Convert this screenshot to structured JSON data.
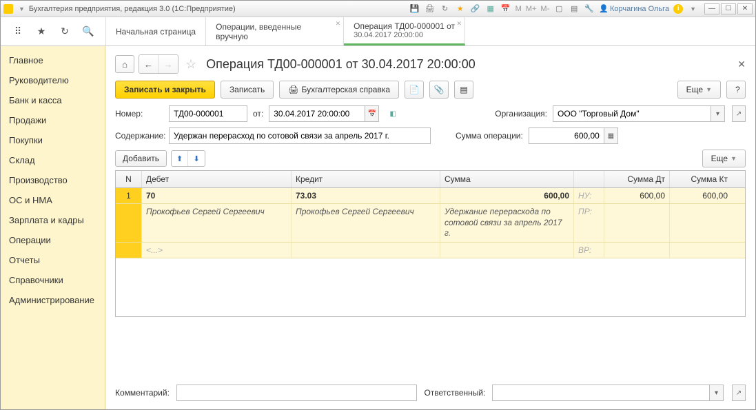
{
  "titlebar": {
    "title": "Бухгалтерия предприятия, редакция 3.0  (1С:Предприятие)",
    "user": "Корчагина Ольга",
    "m": "M",
    "mplus": "M+",
    "mminus": "M-"
  },
  "tabs": [
    {
      "label": "Начальная страница",
      "closable": false
    },
    {
      "label": "Операции, введенные вручную",
      "closable": true
    },
    {
      "label": "Операция ТД00-000001 от",
      "line2": "30.04.2017 20:00:00",
      "closable": true,
      "active": true
    }
  ],
  "sidebar": {
    "items": [
      "Главное",
      "Руководителю",
      "Банк и касса",
      "Продажи",
      "Покупки",
      "Склад",
      "Производство",
      "ОС и НМА",
      "Зарплата и кадры",
      "Операции",
      "Отчеты",
      "Справочники",
      "Администрирование"
    ]
  },
  "page": {
    "title": "Операция ТД00-000001 от 30.04.2017 20:00:00",
    "save_close": "Записать и закрыть",
    "save": "Записать",
    "report": "Бухгалтерская справка",
    "more": "Еще",
    "help": "?",
    "number_label": "Номер:",
    "number": "ТД00-000001",
    "from_label": "от:",
    "date": "30.04.2017 20:00:00",
    "org_label": "Организация:",
    "org": "ООО \"Торговый Дом\"",
    "content_label": "Содержание:",
    "content": "Удержан перерасход по сотовой связи за апрель 2017 г.",
    "sum_label": "Сумма операции:",
    "sum": "600,00",
    "add": "Добавить",
    "comment_label": "Комментарий:",
    "resp_label": "Ответственный:"
  },
  "grid": {
    "headers": {
      "n": "N",
      "debit": "Дебет",
      "credit": "Кредит",
      "sum": "Сумма",
      "sum_dt": "Сумма Дт",
      "sum_kt": "Сумма Кт"
    },
    "row": {
      "n": "1",
      "dt_acc": "70",
      "kt_acc": "73.03",
      "sum": "600,00",
      "tag_nu": "НУ:",
      "sum_dt": "600,00",
      "sum_kt": "600,00",
      "dt_sub": "Прокофьев Сергей Сергеевич",
      "kt_sub": "Прокофьев Сергей Сергеевич",
      "sum_desc": "Удержание перерасхода по сотовой связи за апрель 2017 г.",
      "tag_pr": "ПР:",
      "dt_ellipsis": "<...>",
      "tag_vr": "ВР:"
    }
  }
}
